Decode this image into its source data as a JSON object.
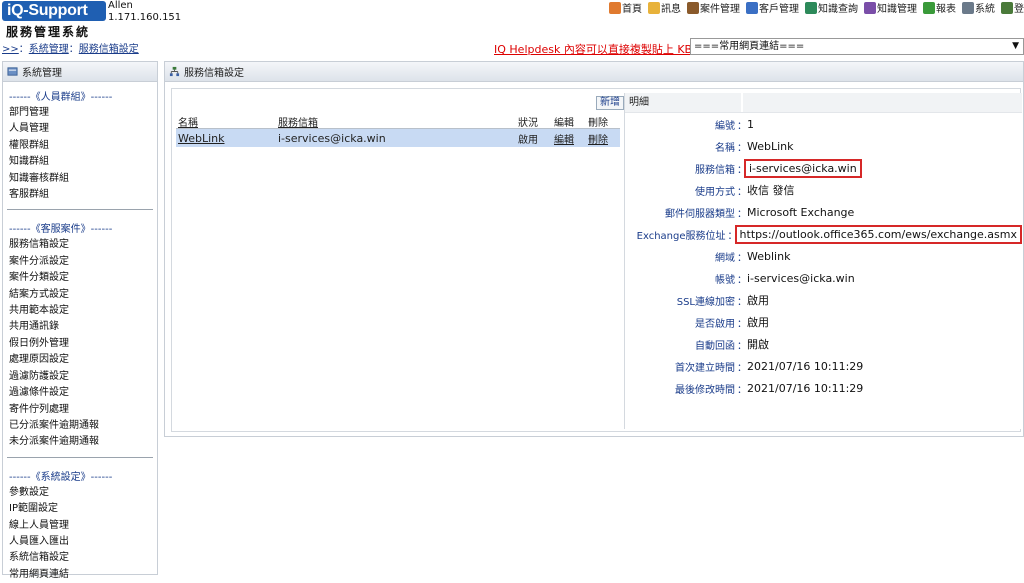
{
  "header": {
    "logo_text": "iQ-Support",
    "user_name": "Allen",
    "user_ip": "1.171.160.151",
    "system_name": "服務管理系統",
    "breadcrumb": {
      "prefix": ">>",
      "separator": "：",
      "level1": "系統管理",
      "sep2": "：",
      "level2": "服務信箱設定"
    },
    "nav": [
      {
        "label": "首頁",
        "icon": "home-icon",
        "color": "#e07a2f"
      },
      {
        "label": "訊息",
        "icon": "mail-icon",
        "color": "#e8b23a"
      },
      {
        "label": "案件管理",
        "icon": "case-icon",
        "color": "#8a5a2b"
      },
      {
        "label": "客戶管理",
        "icon": "customer-icon",
        "color": "#3a6fc4"
      },
      {
        "label": "知識查詢",
        "icon": "search-icon",
        "color": "#2d8a5a"
      },
      {
        "label": "知識管理",
        "icon": "book-icon",
        "color": "#7a4ea8"
      },
      {
        "label": "報表",
        "icon": "report-icon",
        "color": "#3a9a3a"
      },
      {
        "label": "系統",
        "icon": "system-icon",
        "color": "#6b7a8a"
      },
      {
        "label": "登",
        "icon": "logout-icon",
        "color": "#4a7a3a"
      }
    ],
    "kb_link": "IQ Helpdesk 內容可以直接複製貼上 KB",
    "quick_links_select": "===常用網頁連結==="
  },
  "sidebar": {
    "title": "系統管理",
    "groups": [
      {
        "title": "------《人員群組》------",
        "items": [
          "部門管理",
          "人員管理",
          "權限群組",
          "知識群組",
          "知識審核群組",
          "客服群組"
        ]
      },
      {
        "title": "------《客服案件》------",
        "items": [
          "服務信箱設定",
          "案件分派設定",
          "案件分類設定",
          "結案方式設定",
          "共用範本設定",
          "共用通訊錄",
          "假日例外管理",
          "處理原因設定",
          "過濾防護設定",
          "過濾條件設定",
          "寄件佇列處理",
          "已分派案件逾期通報",
          "未分派案件逾期通報"
        ]
      },
      {
        "title": "------《系統設定》------",
        "items": [
          "參數設定",
          "IP範圍設定",
          "線上人員管理",
          "人員匯入匯出",
          "系統信箱設定",
          "常用網頁連結"
        ]
      }
    ]
  },
  "main": {
    "title": "服務信箱設定",
    "add_button": "新增",
    "list": {
      "headers": {
        "name": "名稱",
        "mailbox": "服務信箱",
        "status": "狀況",
        "edit": "編輯",
        "delete": "刪除"
      },
      "rows": [
        {
          "name": "WebLink",
          "mailbox": "i-services@icka.win",
          "status": "啟用",
          "edit": "編輯",
          "delete": "刪除"
        }
      ]
    },
    "detail": {
      "header": "明細",
      "colon": "：",
      "fields": [
        {
          "label": "編號",
          "value": "1"
        },
        {
          "label": "名稱",
          "value": "WebLink"
        },
        {
          "label": "服務信箱",
          "value": "i-services@icka.win",
          "highlight": true
        },
        {
          "label": "使用方式",
          "value": "收信 發信"
        },
        {
          "label": "郵件伺服器類型",
          "value": "Microsoft Exchange"
        },
        {
          "label": "Exchange服務位址",
          "value": "https://outlook.office365.com/ews/exchange.asmx",
          "highlight": true
        },
        {
          "label": "網域",
          "value": "Weblink"
        },
        {
          "label": "帳號",
          "value": "i-services@icka.win"
        },
        {
          "label": "SSL連線加密",
          "value": "啟用"
        },
        {
          "label": "是否啟用",
          "value": "啟用"
        },
        {
          "label": "自動回函",
          "value": "開啟"
        },
        {
          "label": "首次建立時間",
          "value": "2021/07/16 10:11:29"
        },
        {
          "label": "最後修改時間",
          "value": "2021/07/16 10:11:29"
        }
      ]
    }
  }
}
